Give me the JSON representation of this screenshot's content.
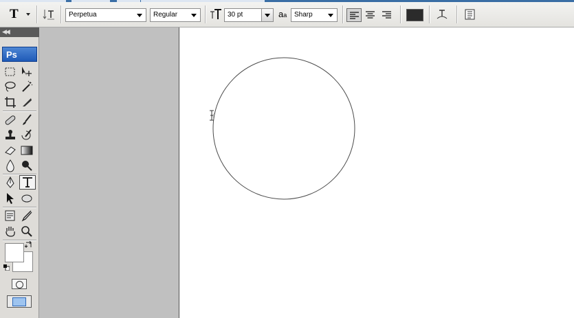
{
  "options_bar": {
    "tool_preset_icon": "horizontal-type-tool-icon",
    "orientation_icon": "text-orientation-icon",
    "font_family": "Perpetua",
    "font_style": "Regular",
    "font_size_icon": "font-size-icon",
    "font_size": "30 pt",
    "antialias_icon": "aa-icon",
    "antialias_label": "a",
    "antialias_label_small": "a",
    "antialias": "Sharp",
    "align_left_icon": "align-left-icon",
    "align_center_icon": "align-center-icon",
    "align_right_icon": "align-right-icon",
    "text_color": "#2b2b2b",
    "warp_icon": "warp-text-icon",
    "panels_icon": "character-paragraph-panels-icon"
  },
  "toolbox": {
    "logo": "Ps",
    "collapse_icon": "double-chevron-left-icon",
    "active_tool": "type-tool",
    "foreground_color": "#ffffff",
    "background_color": "#ffffff"
  },
  "canvas": {
    "background": "#ffffff",
    "shape": "circle-path",
    "cursor_icon": "type-on-path-cursor-icon"
  }
}
